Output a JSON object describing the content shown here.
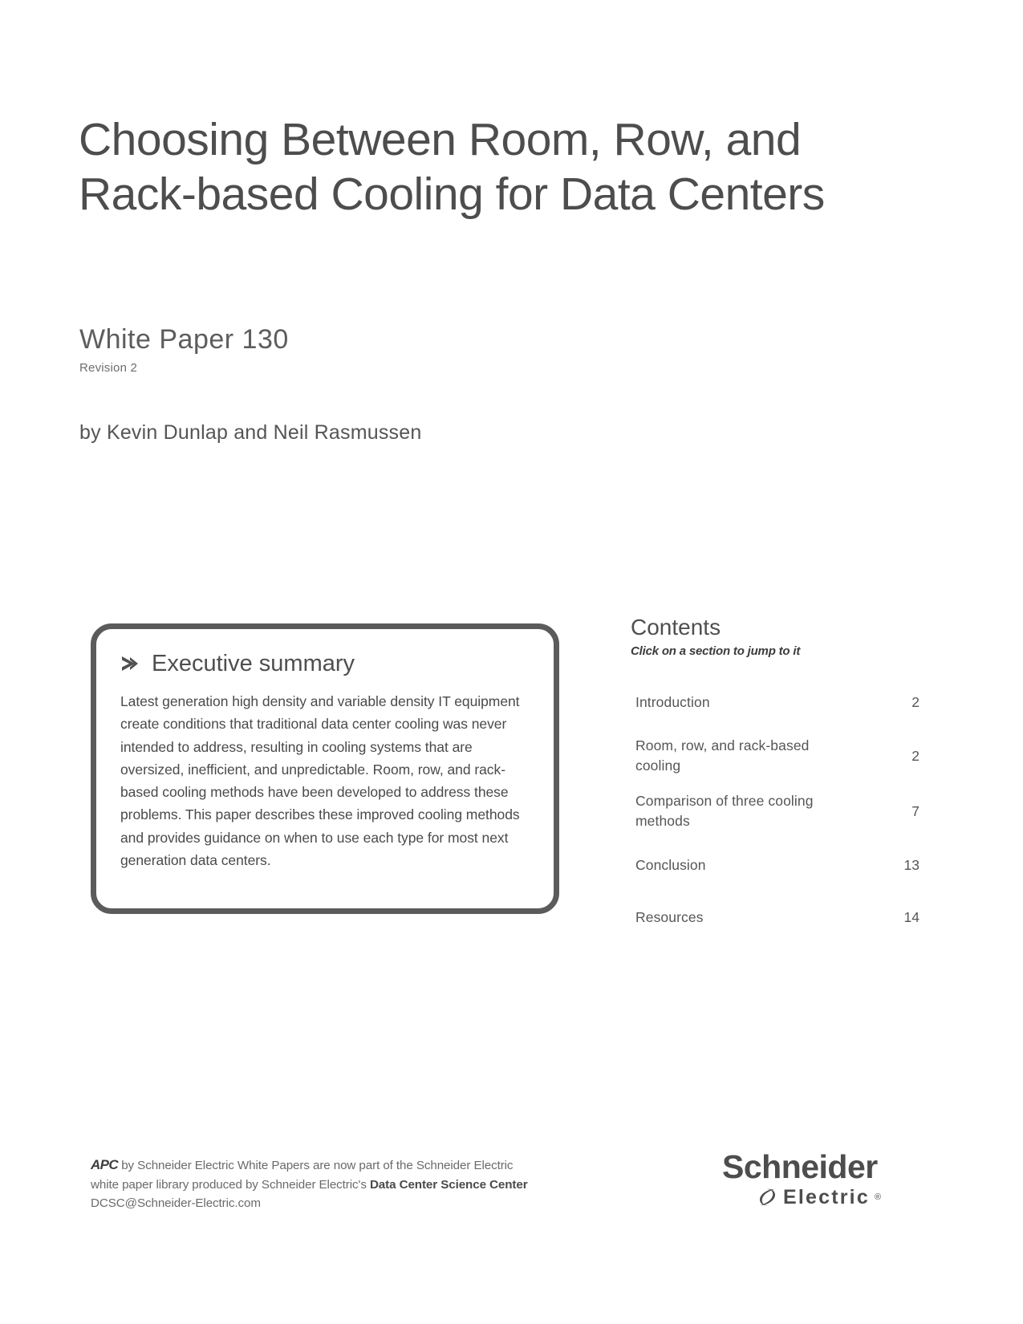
{
  "document": {
    "title_line_1": "Choosing Between Room, Row, and",
    "title_line_2": "Rack-based Cooling for Data Centers",
    "white_paper_number": "White Paper 130",
    "revision": "Revision 2",
    "authors": "by  Kevin Dunlap  and  Neil Rasmussen"
  },
  "executive_summary": {
    "heading": "Executive summary",
    "icon": "chevron-right-icon",
    "body": "Latest generation high density and variable density IT equipment create conditions that traditional data center cooling was never intended to address, resulting in cooling systems that are oversized, inefficient, and unpredictable.  Room, row, and rack-based cooling methods have been developed to address these problems.  This paper describes these improved cooling methods and provides guidance on when to use each type for most next generation data centers."
  },
  "contents": {
    "title": "Contents",
    "subtitle": "Click on a section to jump to it",
    "items": [
      {
        "label": "Introduction",
        "page": "2"
      },
      {
        "label": "Room, row, and rack-based cooling",
        "page": "2"
      },
      {
        "label": "Comparison of three cooling methods",
        "page": "7"
      },
      {
        "label": "Conclusion",
        "page": "13"
      },
      {
        "label": "Resources",
        "page": "14"
      }
    ]
  },
  "footer": {
    "brand_mark": "APC",
    "line_1_rest": " by Schneider Electric White Papers are now part of the Schneider Electric",
    "line_2_prefix": "white paper library produced by Schneider Electric's ",
    "line_2_bold": "Data Center Science Center",
    "line_3": "DCSC@Schneider-Electric.com",
    "logo_top": "Schneider",
    "logo_bottom": "Electric",
    "logo_registered": "®"
  },
  "colors": {
    "text": "#5a5a5a",
    "heading": "#4d4d4d",
    "box_border": "#5b5b5b",
    "background": "#ffffff"
  }
}
